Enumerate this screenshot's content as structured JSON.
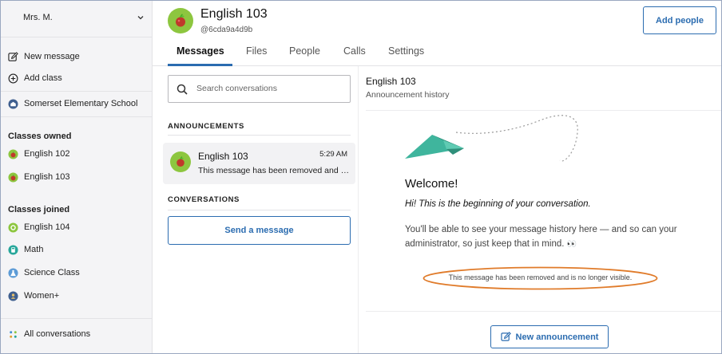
{
  "sidebar": {
    "user_name": "Mrs. M.",
    "new_message": "New message",
    "add_class": "Add class",
    "school": "Somerset Elementary School",
    "classes_owned_title": "Classes owned",
    "classes_owned": [
      {
        "label": "English 102",
        "color": "#8dc63f"
      },
      {
        "label": "English 103",
        "color": "#8dc63f"
      }
    ],
    "classes_joined_title": "Classes joined",
    "classes_joined": [
      {
        "label": "English 104",
        "color": "#8dc63f"
      },
      {
        "label": "Math",
        "color": "#26a69a"
      },
      {
        "label": "Science Class",
        "color": "#5c9bd6"
      },
      {
        "label": "Women+",
        "color": "#3f5f8f"
      }
    ],
    "all_conversations": "All conversations"
  },
  "header": {
    "class_title": "English 103",
    "class_code": "@6cda9a4d9b",
    "add_people": "Add people",
    "tabs": [
      {
        "label": "Messages",
        "active": true
      },
      {
        "label": "Files",
        "active": false
      },
      {
        "label": "People",
        "active": false
      },
      {
        "label": "Calls",
        "active": false
      },
      {
        "label": "Settings",
        "active": false
      }
    ]
  },
  "list": {
    "search_placeholder": "Search conversations",
    "announcements_title": "ANNOUNCEMENTS",
    "conversation": {
      "title": "English 103",
      "time": "5:29 AM",
      "preview": "This message has been removed and is no longer visible."
    },
    "conversations_title": "CONVERSATIONS",
    "send_message": "Send a message"
  },
  "pane": {
    "title": "English 103",
    "subtitle": "Announcement history",
    "welcome": "Welcome!",
    "hi": "Hi! This is the beginning of your conversation.",
    "body": "You'll be able to see your message history here — and so can your administrator, so just keep that in mind.",
    "eyes": "👀",
    "removed": "This message has been removed and is no longer visible.",
    "new_announcement": "New announcement"
  },
  "colors": {
    "accent": "#2b6cb0",
    "avatar_green": "#8dc63f",
    "plane": "#3fb59d",
    "highlight_ellipse": "#e07b2a"
  }
}
